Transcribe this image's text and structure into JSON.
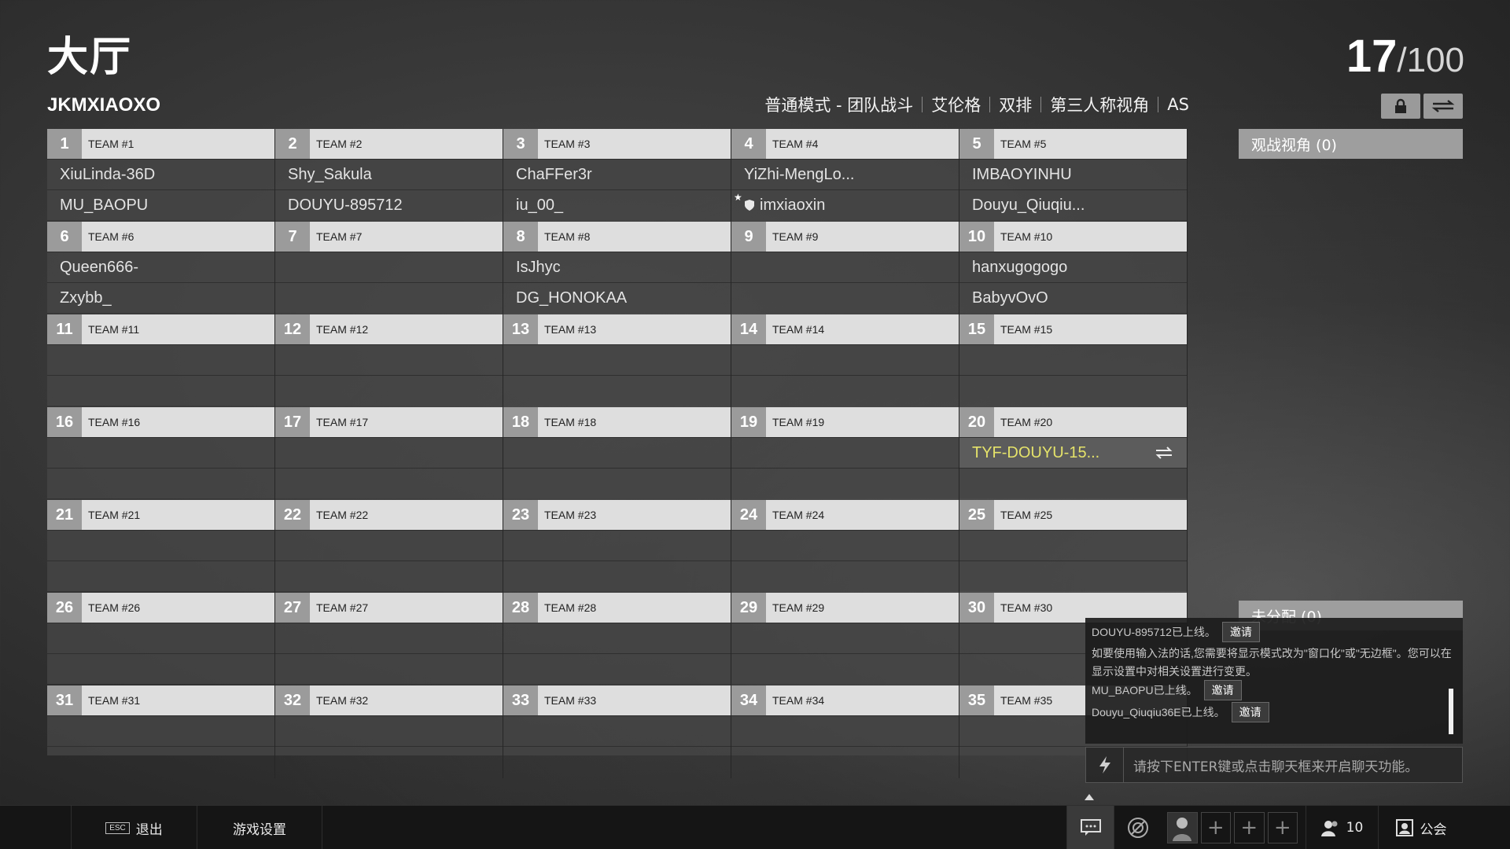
{
  "page": {
    "title": "大厅",
    "host": "JKMXIAOXO",
    "player_count": "17",
    "player_max": "/100"
  },
  "modes": [
    "普通模式 - 团队战斗",
    "艾伦格",
    "双排",
    "第三人称视角",
    "AS"
  ],
  "icons": {
    "lock": "lock-icon",
    "swap": "swap-icon",
    "chat": "chat-icon",
    "bolt": "lightning-icon"
  },
  "teams": [
    {
      "num": "1",
      "name": "TEAM #1",
      "players": [
        "XiuLinda-36D",
        "MU_BAOPU"
      ]
    },
    {
      "num": "2",
      "name": "TEAM #2",
      "players": [
        "Shy_Sakula",
        "DOUYU-895712"
      ]
    },
    {
      "num": "3",
      "name": "TEAM #3",
      "players": [
        "ChaFFer3r",
        "iu_00_"
      ]
    },
    {
      "num": "4",
      "name": "TEAM #4",
      "players": [
        "YiZhi-MengLo...",
        "imxiaoxin"
      ]
    },
    {
      "num": "5",
      "name": "TEAM #5",
      "players": [
        "IMBAOYINHU",
        "Douyu_Qiuqiu..."
      ]
    },
    {
      "num": "6",
      "name": "TEAM #6",
      "players": [
        "Queen666-",
        "Zxybb_"
      ]
    },
    {
      "num": "7",
      "name": "TEAM #7",
      "players": [
        "",
        ""
      ]
    },
    {
      "num": "8",
      "name": "TEAM #8",
      "players": [
        "IsJhyc",
        "DG_HONOKAA"
      ]
    },
    {
      "num": "9",
      "name": "TEAM #9",
      "players": [
        "",
        ""
      ]
    },
    {
      "num": "10",
      "name": "TEAM #10",
      "players": [
        "hanxugogogo",
        "BabyvOvO"
      ]
    },
    {
      "num": "11",
      "name": "TEAM #11",
      "players": [
        "",
        ""
      ]
    },
    {
      "num": "12",
      "name": "TEAM #12",
      "players": [
        "",
        ""
      ]
    },
    {
      "num": "13",
      "name": "TEAM #13",
      "players": [
        "",
        ""
      ]
    },
    {
      "num": "14",
      "name": "TEAM #14",
      "players": [
        "",
        ""
      ]
    },
    {
      "num": "15",
      "name": "TEAM #15",
      "players": [
        "",
        ""
      ]
    },
    {
      "num": "16",
      "name": "TEAM #16",
      "players": [
        "",
        ""
      ]
    },
    {
      "num": "17",
      "name": "TEAM #17",
      "players": [
        "",
        ""
      ]
    },
    {
      "num": "18",
      "name": "TEAM #18",
      "players": [
        "",
        ""
      ]
    },
    {
      "num": "19",
      "name": "TEAM #19",
      "players": [
        "",
        ""
      ]
    },
    {
      "num": "20",
      "name": "TEAM #20",
      "players": [
        "TYF-DOUYU-15...",
        ""
      ]
    },
    {
      "num": "21",
      "name": "TEAM #21",
      "players": [
        "",
        ""
      ]
    },
    {
      "num": "22",
      "name": "TEAM #22",
      "players": [
        "",
        ""
      ]
    },
    {
      "num": "23",
      "name": "TEAM #23",
      "players": [
        "",
        ""
      ]
    },
    {
      "num": "24",
      "name": "TEAM #24",
      "players": [
        "",
        ""
      ]
    },
    {
      "num": "25",
      "name": "TEAM #25",
      "players": [
        "",
        ""
      ]
    },
    {
      "num": "26",
      "name": "TEAM #26",
      "players": [
        "",
        ""
      ]
    },
    {
      "num": "27",
      "name": "TEAM #27",
      "players": [
        "",
        ""
      ]
    },
    {
      "num": "28",
      "name": "TEAM #28",
      "players": [
        "",
        ""
      ]
    },
    {
      "num": "29",
      "name": "TEAM #29",
      "players": [
        "",
        ""
      ]
    },
    {
      "num": "30",
      "name": "TEAM #30",
      "players": [
        "",
        ""
      ]
    },
    {
      "num": "31",
      "name": "TEAM #31",
      "players": [
        "",
        ""
      ]
    },
    {
      "num": "32",
      "name": "TEAM #32",
      "players": [
        "",
        ""
      ]
    },
    {
      "num": "33",
      "name": "TEAM #33",
      "players": [
        "",
        ""
      ]
    },
    {
      "num": "34",
      "name": "TEAM #34",
      "players": [
        "",
        ""
      ]
    },
    {
      "num": "35",
      "name": "TEAM #35",
      "players": [
        "",
        ""
      ]
    }
  ],
  "spectator": {
    "label": "观战视角 (0)"
  },
  "unassigned": {
    "label": "未分配 (0)"
  },
  "chat": {
    "lines": [
      {
        "text": "DOUYU-895712已上线。",
        "action": "邀请"
      },
      {
        "text": "如要使用输入法的话,您需要将显示模式改为\"窗口化\"或\"无边框\"。您可以在显示设置中对相关设置进行变更。",
        "action": ""
      },
      {
        "text": "MU_BAOPU已上线。",
        "action": "邀请"
      },
      {
        "text": "Douyu_Qiuqiu36E已上线。",
        "action": "邀请"
      }
    ],
    "input_placeholder": "请按下ENTER键或点击聊天框来开启聊天功能。"
  },
  "bottom": {
    "esc_key": "ESC",
    "exit": "退出",
    "settings": "游戏设置",
    "friends_count": "10",
    "guild": "公会"
  },
  "highlight_color": "#e5e36a"
}
